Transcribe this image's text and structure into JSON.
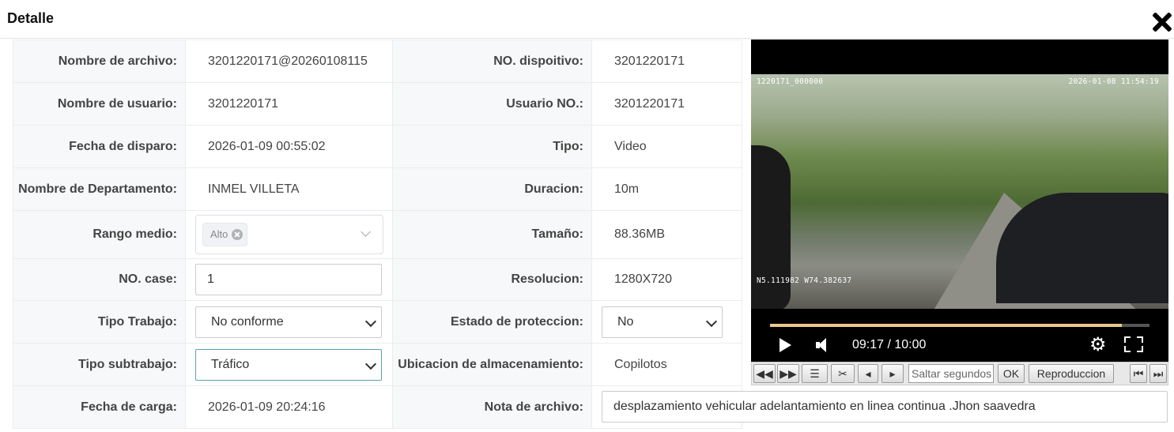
{
  "dialog": {
    "title": "Detalle"
  },
  "fields": {
    "nombre_archivo": {
      "label": "Nombre de archivo:",
      "value": "3201220171@20260108115"
    },
    "no_dispositivo": {
      "label": "NO. dispoitivo:",
      "value": "3201220171"
    },
    "nombre_usuario": {
      "label": "Nombre de usuario:",
      "value": "3201220171"
    },
    "usuario_no": {
      "label": "Usuario NO.:",
      "value": "3201220171"
    },
    "fecha_disparo": {
      "label": "Fecha de disparo:",
      "value": "2026-01-09 00:55:02"
    },
    "tipo": {
      "label": "Tipo:",
      "value": "Video"
    },
    "nombre_departamento": {
      "label": "Nombre de Departamento:",
      "value": "INMEL VILLETA"
    },
    "duracion": {
      "label": "Duracion:",
      "value": "10m"
    },
    "rango_medio": {
      "label": "Rango medio:",
      "tag": "Alto"
    },
    "tamano": {
      "label": "Tamaño:",
      "value": "88.36MB"
    },
    "no_case": {
      "label": "NO. case:",
      "value": "1"
    },
    "resolucion": {
      "label": "Resolucion:",
      "value": "1280X720"
    },
    "tipo_trabajo": {
      "label": "Tipo Trabajo:",
      "value": "No conforme"
    },
    "estado_proteccion": {
      "label": "Estado de proteccion:",
      "value": "No"
    },
    "tipo_subtrabajo": {
      "label": "Tipo subtrabajo:",
      "value": "Tráfico"
    },
    "ubicacion_almacenamiento": {
      "label": "Ubicacion de almacenamiento:",
      "value": "Copilotos"
    },
    "fecha_carga": {
      "label": "Fecha de carga:",
      "value": "2026-01-09 20:24:16"
    },
    "nota_archivo": {
      "label": "Nota de archivo:",
      "value": "desplazamiento vehicular adelantamiento en linea continua .Jhon saavedra"
    }
  },
  "player": {
    "osd_left": "1220171_000000",
    "osd_datetime": "2026-01-08 11:54:19",
    "osd_gps": "N5.111982 W74.382637",
    "time": "09:17 / 10:00",
    "progress": 0.928
  },
  "toolbar": {
    "rewind_icon": "◀◀",
    "forward_icon": "▶▶",
    "list_icon": "☰",
    "cut_icon": "✂",
    "prev_frame_icon": "◂",
    "next_frame_icon": "▸",
    "seek_placeholder": "Saltar segundos",
    "ok_label": "OK",
    "playback_label": "Reproduccion",
    "first_icon": "⏮",
    "last_icon": "⏭"
  },
  "colors": {
    "progress_fill": "#e8c98a",
    "focus_border": "#5aa1b3"
  }
}
